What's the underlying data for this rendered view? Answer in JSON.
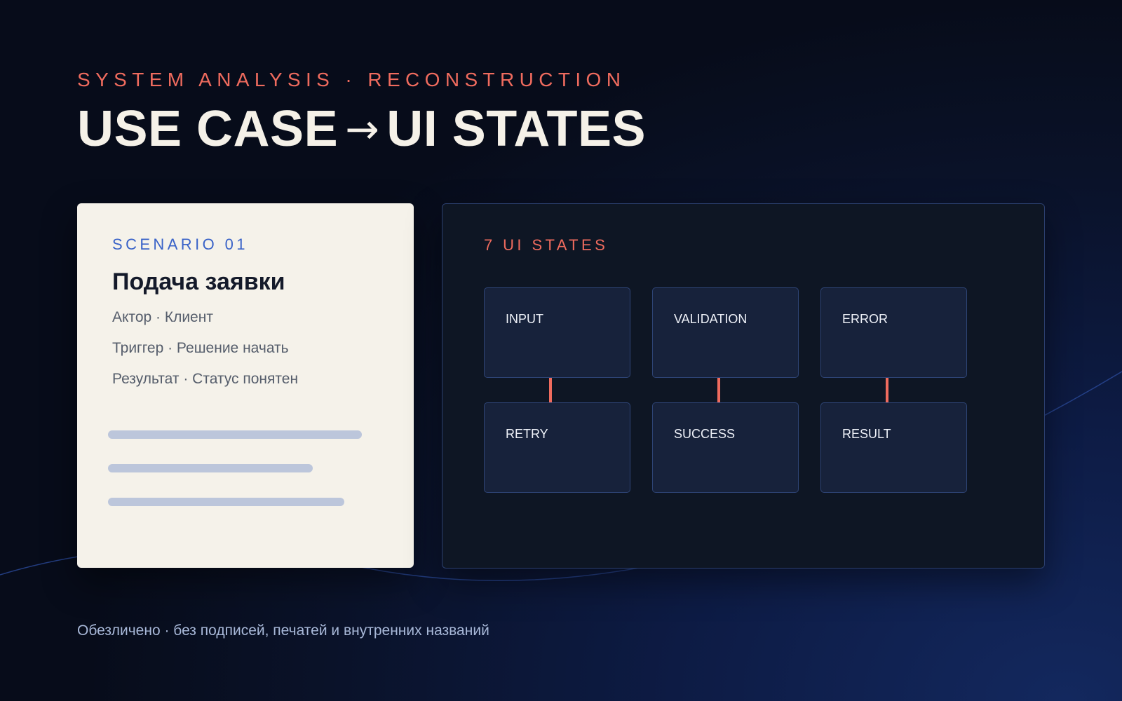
{
  "header": {
    "eyebrow": "SYSTEM ANALYSIS · RECONSTRUCTION",
    "title_left": "USE CASE",
    "title_arrow": "→",
    "title_right": "UI STATES"
  },
  "scenario": {
    "eyebrow": "SCENARIO 01",
    "title": "Подача заявки",
    "lines": [
      "Актор · Клиент",
      "Триггер · Решение начать",
      "Результат · Статус понятен"
    ]
  },
  "states_panel": {
    "eyebrow": "7 UI STATES",
    "states": [
      "INPUT",
      "VALIDATION",
      "ERROR",
      "RETRY",
      "SUCCESS",
      "RESULT"
    ]
  },
  "footer": {
    "note": "Обезличено · без подписей, печатей и внутренних названий"
  },
  "colors": {
    "accent": "#ef6b5e",
    "scenario_accent": "#3a63c8",
    "card_light": "#f5f2ea",
    "card_dark": "#0e1624",
    "state_box": "#17223b"
  }
}
